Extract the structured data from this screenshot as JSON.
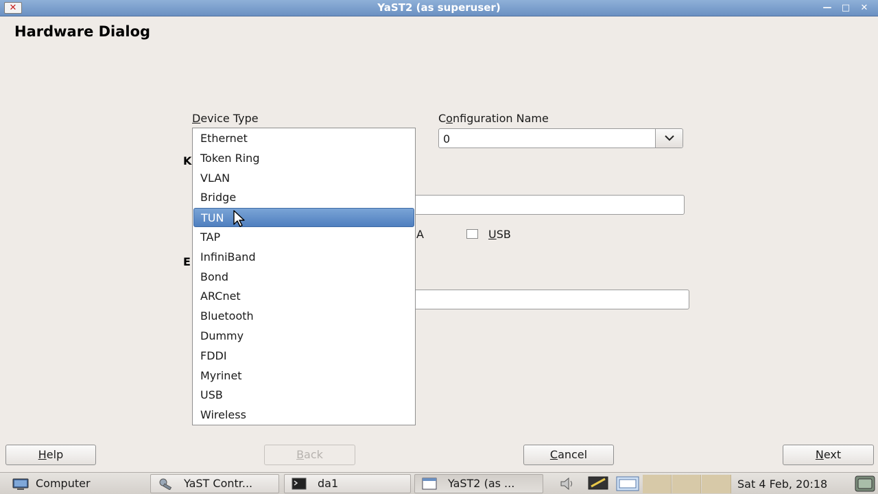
{
  "window": {
    "title": "YaST2 (as superuser)",
    "close_glyph": "✕",
    "minimize_glyph": "—",
    "maximize_glyph": "□",
    "close2_glyph": "✕"
  },
  "page_title": "Hardware Dialog",
  "labels": {
    "device_type": "Device Type",
    "device_type_mnemonic": "D",
    "device_type_rest": "evice Type",
    "config_name": "Configuration Name",
    "config_name_mnemonic": "o",
    "config_name_pre": "C",
    "config_name_rest": "nfiguration Name",
    "peek_k": "K",
    "peek_e": "E",
    "peek_a": "A",
    "usb_checkbox": "USB",
    "usb_mnemonic": "U",
    "usb_rest": "SB"
  },
  "config_name_value": "0",
  "device_types": [
    "Ethernet",
    "Token Ring",
    "VLAN",
    "Bridge",
    "TUN",
    "TAP",
    "InfiniBand",
    "Bond",
    "ARCnet",
    "Bluetooth",
    "Dummy",
    "FDDI",
    "Myrinet",
    "USB",
    "Wireless"
  ],
  "selected_device_type": "TUN",
  "buttons": {
    "help": "Help",
    "help_mn": "H",
    "help_rest": "elp",
    "back": "Back",
    "back_mn": "B",
    "back_rest": "ack",
    "cancel": "Cancel",
    "cancel_mn": "C",
    "cancel_rest": "ancel",
    "next": "Next",
    "next_mn": "N",
    "next_rest": "ext"
  },
  "taskbar": {
    "computer": "Computer",
    "items": [
      "YaST Contr...",
      "da1",
      "YaST2 (as ..."
    ],
    "clock": "Sat  4 Feb, 20:18"
  },
  "colors": {
    "titlebar": "#6a90c2",
    "selection": "#5a88c6",
    "background": "#efebe7"
  }
}
